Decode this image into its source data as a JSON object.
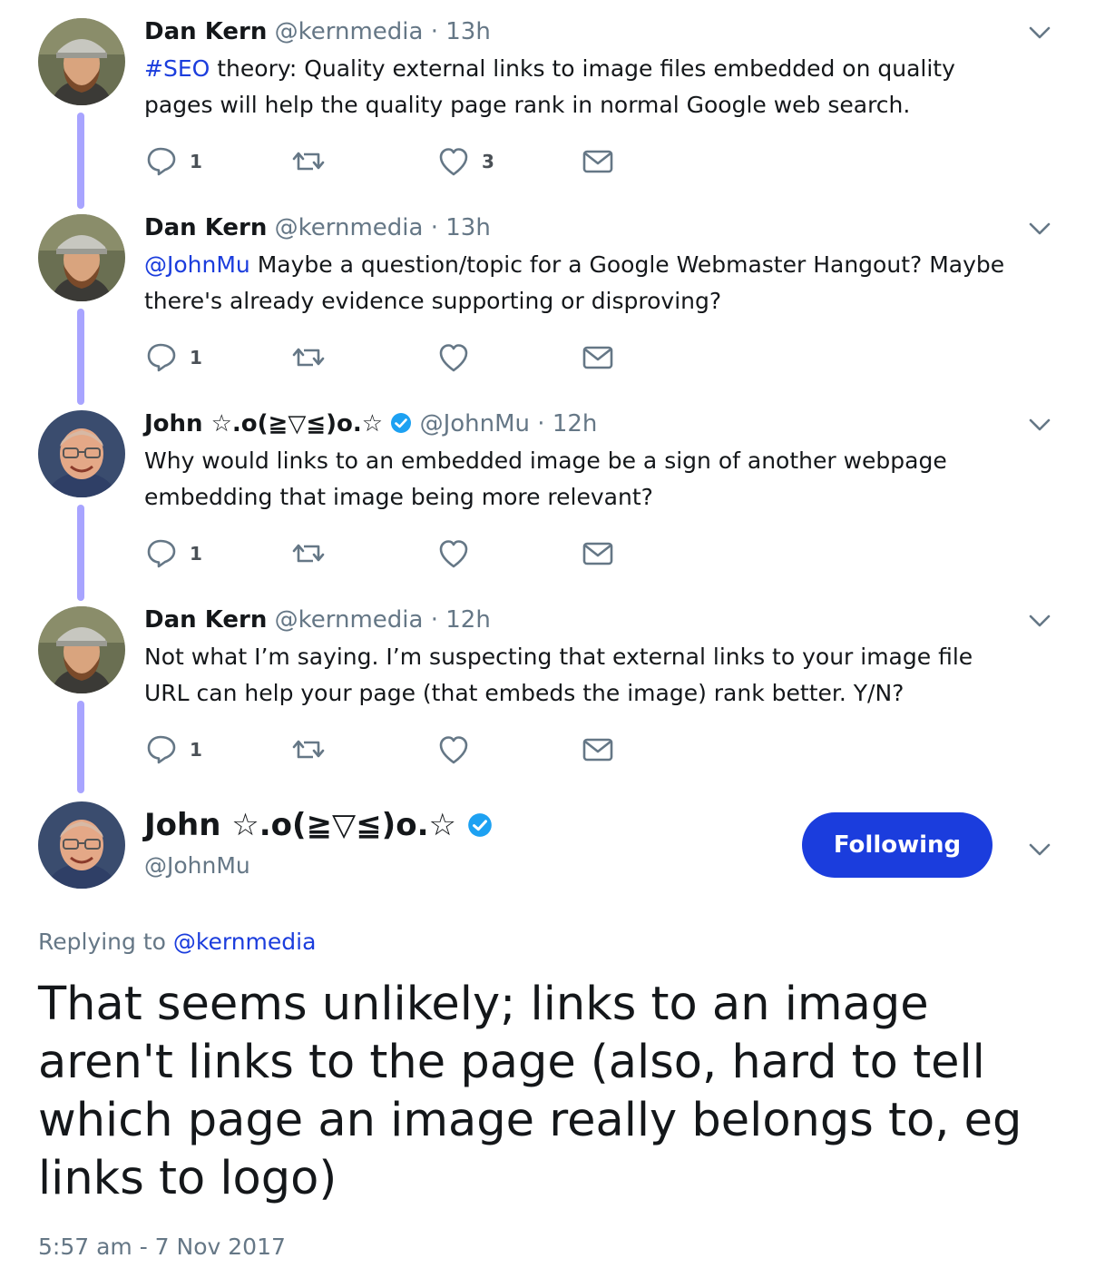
{
  "thread": [
    {
      "name": "Dan Kern",
      "handle": "@kernmedia",
      "time": "13h",
      "text_prefix": "#SEO",
      "text": " theory: Quality external links to image files embedded on quality pages will help the quality page rank in normal Google web search.",
      "replies": "1",
      "retweets": "",
      "likes": "3"
    },
    {
      "name": "Dan Kern",
      "handle": "@kernmedia",
      "time": "13h",
      "text_prefix": "@JohnMu",
      "text": " Maybe a question/topic for a Google Webmaster Hangout? Maybe there's already evidence supporting or disproving?",
      "replies": "1",
      "retweets": "",
      "likes": ""
    },
    {
      "name": "John ☆.o(≧▽≦)o.☆",
      "handle": "@JohnMu",
      "time": "12h",
      "text_prefix": "",
      "text": "Why would links to an embedded image be a sign of another webpage embedding that image being more relevant?",
      "replies": "1",
      "retweets": "",
      "likes": ""
    },
    {
      "name": "Dan Kern",
      "handle": "@kernmedia",
      "time": "12h",
      "text_prefix": "",
      "text": "Not what I’m saying. I’m suspecting that external links to your image file URL can help your page (that embeds the image) rank better. Y/N?",
      "replies": "1",
      "retweets": "",
      "likes": ""
    }
  ],
  "separator": "·",
  "main": {
    "name": "John ☆.o(≧▽≦)o.☆",
    "handle": "@JohnMu",
    "follow_label": "Following",
    "replying_label": "Replying to ",
    "replying_handle": "@kernmedia",
    "text": "That seems unlikely; links to an image aren't links to the page (also, hard to tell which page an image really belongs to, eg links to logo)",
    "timestamp": "5:57 am - 7 Nov 2017"
  },
  "colors": {
    "link": "#1b3ddd",
    "thread_line": "#a8a4ff",
    "muted": "#657786",
    "verified": "#1da1f2"
  },
  "icons": [
    "reply-icon",
    "retweet-icon",
    "like-icon",
    "direct-message-icon",
    "caret-down-icon",
    "verified-badge-icon"
  ]
}
